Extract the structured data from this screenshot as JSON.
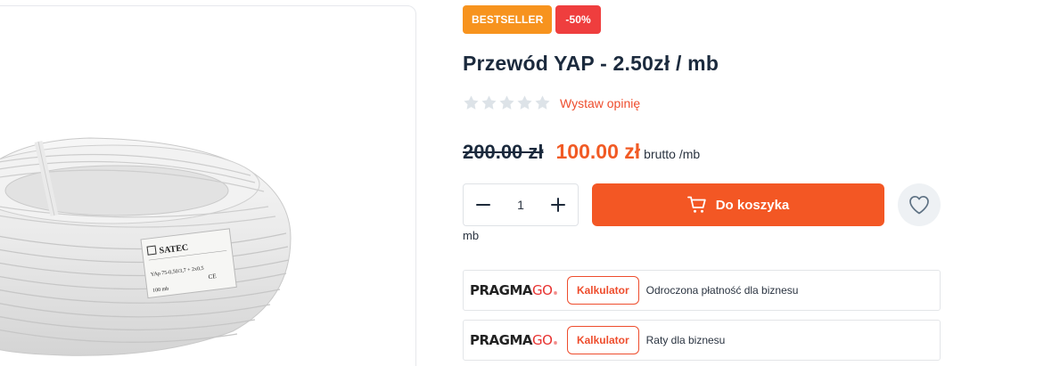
{
  "badges": {
    "bestseller": "BESTSELLER",
    "discount": "-50%"
  },
  "product": {
    "title": "Przewód YAP - 2.50zł / mb",
    "review_link": "Wystaw opinię",
    "rating_stars": 0,
    "rating_max": 5
  },
  "image_label": {
    "brand": "SATEC",
    "spec": "YAp 75-0,50/3,7 + 2x0,5",
    "length": "100 mb",
    "ce": "CE"
  },
  "price": {
    "old": "200.00 zł",
    "new": "100.00 zł",
    "unit": "brutto /mb"
  },
  "quantity": {
    "value": "1",
    "unit": "mb"
  },
  "cart": {
    "label": "Do koszyka"
  },
  "financing": [
    {
      "logo_black": "PRAGMA",
      "logo_red": "GO",
      "logo_reg": "®",
      "button": "Kalkulator",
      "description": "Odroczona płatność dla biznesu"
    },
    {
      "logo_black": "PRAGMA",
      "logo_red": "GO",
      "logo_reg": "®",
      "button": "Kalkulator",
      "description": "Raty dla biznesu"
    }
  ],
  "colors": {
    "accent": "#f35724",
    "bestseller": "#f7931e",
    "sale": "#ef3e3e",
    "star_empty": "#dde3e8"
  }
}
